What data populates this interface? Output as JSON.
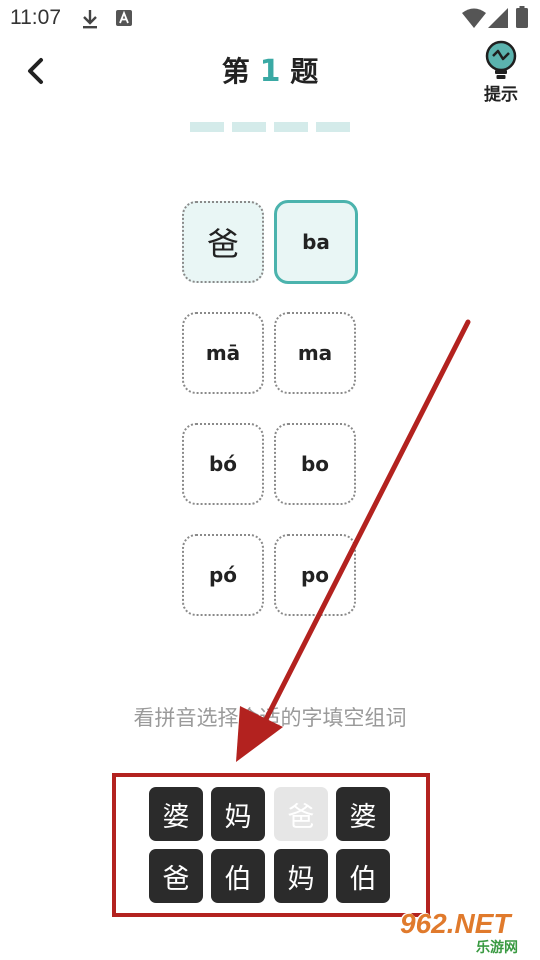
{
  "status_bar": {
    "time": "11:07",
    "icons": [
      "download-icon",
      "font-a-icon",
      "wifi-icon",
      "signal-icon",
      "battery-icon"
    ]
  },
  "header": {
    "title_prefix": "第",
    "title_number": "1",
    "title_suffix": "题",
    "hint_label": "提示",
    "accent_color": "#3aa9a4"
  },
  "progress": {
    "total": 4,
    "current": 1
  },
  "tiles": {
    "row1": {
      "left": "爸",
      "right": "ba"
    },
    "row2": {
      "left": "mā",
      "right": "ma"
    },
    "row3": {
      "left": "bó",
      "right": "bo"
    },
    "row4": {
      "left": "pó",
      "right": "po"
    }
  },
  "instruction": "看拼音选择合适的字填空组词",
  "answer_keys": {
    "row1": [
      "婆",
      "妈",
      "爸",
      "婆"
    ],
    "row2": [
      "爸",
      "伯",
      "妈",
      "伯"
    ],
    "used_index": 2
  },
  "watermark": {
    "brand": "962.NET",
    "site": "乐游网"
  }
}
